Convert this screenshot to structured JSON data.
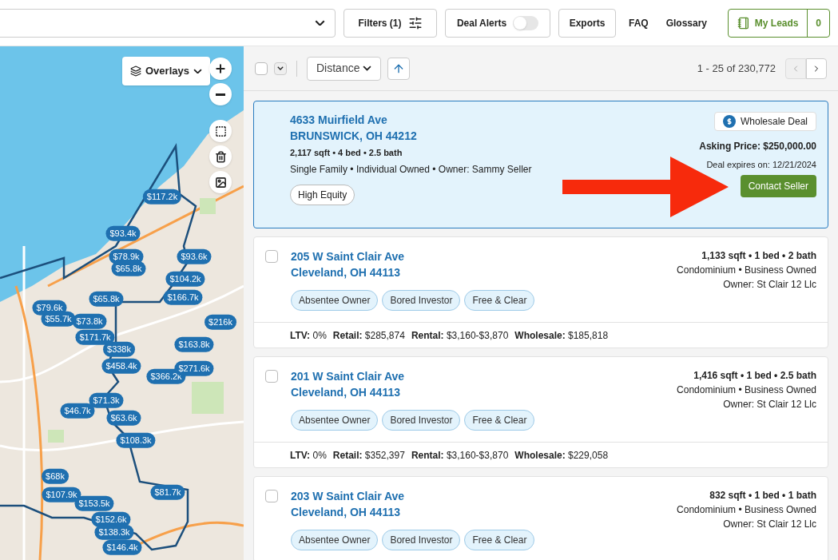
{
  "header": {
    "filters": "Filters (1)",
    "deal_alerts": {
      "label": "Deal Alerts",
      "on": false
    },
    "exports": "Exports",
    "links": [
      "FAQ",
      "Glossary"
    ],
    "my_leads": {
      "label": "My Leads",
      "count": "0"
    }
  },
  "map": {
    "overlays": "Overlays",
    "pins": [
      "$117.2k",
      "$93.4k",
      "$78.9k",
      "$65.8k",
      "$93.6k",
      "$104.2k",
      "$65.8k",
      "$166.7k",
      "$79.6k",
      "$55.7k",
      "$73.8k",
      "$216k",
      "$171.7k",
      "$338k",
      "$163.8k",
      "$458.4k",
      "$366.2k",
      "$271.6k",
      "$71.3k",
      "$46.7k",
      "$63.6k",
      "$108.3k",
      "$68k",
      "$107.9k",
      "$153.5k",
      "$81.7k",
      "$152.6k",
      "$138.3k",
      "$146.4k"
    ]
  },
  "toolbar": {
    "select_all_checked": false,
    "sort": "Distance",
    "range": "1 - 25 of 230,772"
  },
  "featured": {
    "address": "4633 Muirfield Ave",
    "city": "BRUNSWICK, OH 44212",
    "specs": "2,117 sqft • 4 bed • 2.5 bath",
    "details": "Single Family • Individual Owned • Owner: Sammy Seller",
    "tags": [
      "High Equity"
    ],
    "badge": "Wholesale Deal",
    "asking_label": "Asking Price:",
    "asking_value": "$250,000.00",
    "expires": "Deal expires on: 12/21/2024",
    "action": "Contact Seller"
  },
  "listings": [
    {
      "checked": false,
      "address": "205 W Saint Clair Ave",
      "city": "Cleveland, OH 44113",
      "specs": "1,133 sqft • 1 bed • 2 bath",
      "type": "Condominium • Business Owned",
      "owner": "Owner: St Clair 12 Llc",
      "tags": [
        "Absentee Owner",
        "Bored Investor",
        "Free & Clear"
      ],
      "metrics": [
        {
          "label": "LTV:",
          "value": "0%"
        },
        {
          "label": "Retail:",
          "value": "$285,874"
        },
        {
          "label": "Rental:",
          "value": "$3,160-$3,870"
        },
        {
          "label": "Wholesale:",
          "value": "$185,818"
        }
      ]
    },
    {
      "checked": false,
      "address": "201 W Saint Clair Ave",
      "city": "Cleveland, OH 44113",
      "specs": "1,416 sqft • 1 bed • 2.5 bath",
      "type": "Condominium • Business Owned",
      "owner": "Owner: St Clair 12 Llc",
      "tags": [
        "Absentee Owner",
        "Bored Investor",
        "Free & Clear"
      ],
      "metrics": [
        {
          "label": "LTV:",
          "value": "0%"
        },
        {
          "label": "Retail:",
          "value": "$352,397"
        },
        {
          "label": "Rental:",
          "value": "$3,160-$3,870"
        },
        {
          "label": "Wholesale:",
          "value": "$229,058"
        }
      ]
    },
    {
      "checked": false,
      "address": "203 W Saint Clair Ave",
      "city": "Cleveland, OH 44113",
      "specs": "832 sqft • 1 bed • 1 bath",
      "type": "Condominium • Business Owned",
      "owner": "Owner: St Clair 12 Llc",
      "tags": [
        "Absentee Owner",
        "Bored Investor",
        "Free & Clear"
      ]
    }
  ]
}
